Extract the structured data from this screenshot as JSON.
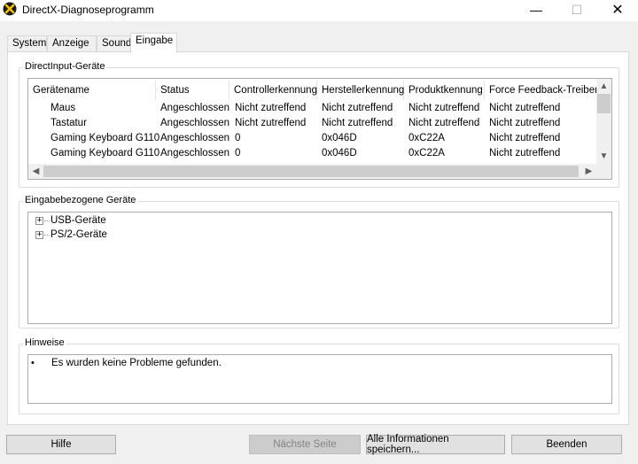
{
  "window": {
    "title": "DirectX-Diagnoseprogramm",
    "minimize_glyph": "—",
    "maximize_glyph": "☐",
    "close_glyph": "✕"
  },
  "tabs": [
    {
      "label": "System",
      "active": false
    },
    {
      "label": "Anzeige",
      "active": false
    },
    {
      "label": "Sound",
      "active": false
    },
    {
      "label": "Eingabe",
      "active": true
    }
  ],
  "directinput": {
    "group_label": "DirectInput-Geräte",
    "columns": [
      "Gerätename",
      "Status",
      "Controllerkennung",
      "Herstellerkennung",
      "Produktkennung",
      "Force Feedback-Treiber"
    ],
    "rows": [
      [
        "Maus",
        "Angeschlossen",
        "Nicht zutreffend",
        "Nicht zutreffend",
        "Nicht zutreffend",
        "Nicht zutreffend"
      ],
      [
        "Tastatur",
        "Angeschlossen",
        "Nicht zutreffend",
        "Nicht zutreffend",
        "Nicht zutreffend",
        "Nicht zutreffend"
      ],
      [
        "Gaming Keyboard G110",
        "Angeschlossen",
        "0",
        "0x046D",
        "0xC22A",
        "Nicht zutreffend"
      ],
      [
        "Gaming Keyboard G110",
        "Angeschlossen",
        "0",
        "0x046D",
        "0xC22A",
        "Nicht zutreffend"
      ]
    ]
  },
  "input_related": {
    "group_label": "Eingabebezogene Geräte",
    "tree": [
      {
        "label": "USB-Geräte",
        "expander": "+"
      },
      {
        "label": "PS/2-Geräte",
        "expander": "+"
      }
    ]
  },
  "notes": {
    "group_label": "Hinweise",
    "items": [
      "Es wurden keine Probleme gefunden."
    ]
  },
  "buttons": {
    "help": "Hilfe",
    "next_page": "Nächste Seite",
    "save_all": "Alle Informationen speichern...",
    "exit": "Beenden"
  },
  "icons": {
    "app": "directx-icon",
    "scroll_up": "▲",
    "scroll_down": "▼",
    "scroll_left": "◀",
    "scroll_right": "▶",
    "bullet": "•"
  }
}
